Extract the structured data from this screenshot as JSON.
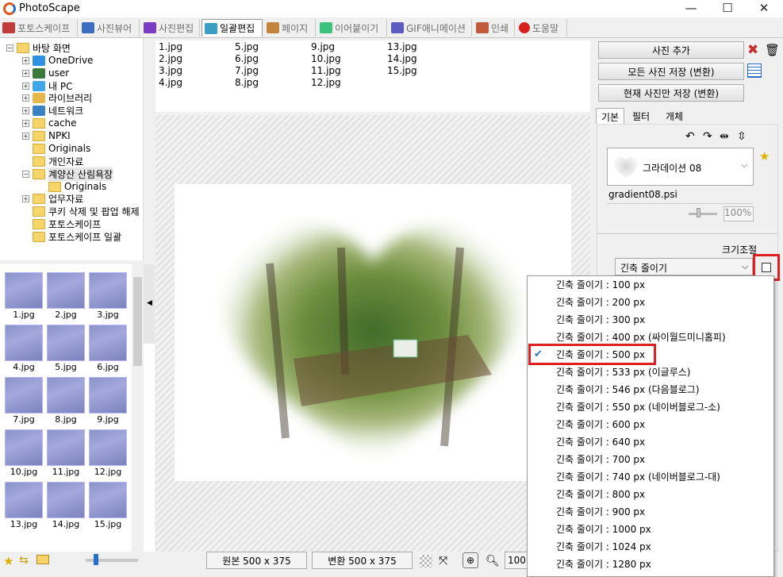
{
  "window": {
    "title": "PhotoScape",
    "minimize": "—",
    "maximize": "☐",
    "close": "✕"
  },
  "tabs": [
    {
      "label": "포토스케이프",
      "color": "#c23b3b"
    },
    {
      "label": "사진뷰어",
      "color": "#3b6ec2"
    },
    {
      "label": "사진편집",
      "color": "#7b3bc2"
    },
    {
      "label": "일괄편집",
      "color": "#3b9ec2"
    },
    {
      "label": "페이지",
      "color": "#c2853b"
    },
    {
      "label": "이어붙이기",
      "color": "#3bc27b"
    },
    {
      "label": "GIF애니메이션",
      "color": "#5b5bc2"
    },
    {
      "label": "인쇄",
      "color": "#c25b3b"
    },
    {
      "label": "도움말",
      "color": "#d62020"
    }
  ],
  "active_tab": 3,
  "tree": [
    {
      "label": "바탕 화면",
      "icon": "folder-icon"
    },
    {
      "label": "OneDrive",
      "icon": "cloud-icon"
    },
    {
      "label": "user",
      "icon": "user-icon"
    },
    {
      "label": "내 PC",
      "icon": "pc-icon"
    },
    {
      "label": "라이브러리",
      "icon": "library-icon"
    },
    {
      "label": "네트워크",
      "icon": "network-icon"
    },
    {
      "label": "cache",
      "icon": "folder-icon"
    },
    {
      "label": "NPKI",
      "icon": "folder-icon"
    },
    {
      "label": "Originals",
      "icon": "folder-icon"
    },
    {
      "label": "개인자료",
      "icon": "folder-icon"
    },
    {
      "label": "계양산 산림욕장",
      "icon": "folder-icon"
    },
    {
      "label": "Originals",
      "icon": "folder-icon"
    },
    {
      "label": "업무자료",
      "icon": "folder-icon"
    },
    {
      "label": "쿠키 삭제 및 팝업 해제",
      "icon": "folder-icon"
    },
    {
      "label": "포토스케이프",
      "icon": "folder-icon"
    },
    {
      "label": "포토스케이프 일괄",
      "icon": "folder-icon"
    }
  ],
  "thumbnails": [
    "1.jpg",
    "2.jpg",
    "3.jpg",
    "4.jpg",
    "5.jpg",
    "6.jpg",
    "7.jpg",
    "8.jpg",
    "9.jpg",
    "10.jpg",
    "11.jpg",
    "12.jpg",
    "13.jpg",
    "14.jpg",
    "15.jpg"
  ],
  "files": [
    "1.jpg",
    "2.jpg",
    "3.jpg",
    "4.jpg",
    "5.jpg",
    "6.jpg",
    "7.jpg",
    "8.jpg",
    "9.jpg",
    "10.jpg",
    "11.jpg",
    "12.jpg",
    "13.jpg",
    "14.jpg",
    "15.jpg"
  ],
  "status": {
    "original": "원본 500 x 375",
    "converted": "변환 500 x 375",
    "zoom": "100"
  },
  "panel": {
    "add_photo": "사진 추가",
    "save_all": "모든 사진 저장 (변환)",
    "save_current": "현재 사진만 저장 (변환)",
    "subtabs": [
      "기본",
      "필터",
      "개체"
    ],
    "gradient_name": "그라데이션 08",
    "gradient_file": "gradient08.psi",
    "opacity": "100%",
    "resize_label": "크기조절",
    "resize_value": "긴축 줄이기"
  },
  "dropdown_options": [
    "긴축 줄이기 : 100 px",
    "긴축 줄이기 : 200 px",
    "긴축 줄이기 : 300 px",
    "긴축 줄이기 : 400 px (싸이월드미니홈피)",
    "긴축 줄이기 : 500 px",
    "긴축 줄이기 : 533 px (이글루스)",
    "긴축 줄이기 : 546 px (다음블로그)",
    "긴축 줄이기 : 550 px (네이버블로그-소)",
    "긴축 줄이기 : 600 px",
    "긴축 줄이기 : 640 px",
    "긴축 줄이기 : 700 px",
    "긴축 줄이기 : 740 px (네이버블로그-대)",
    "긴축 줄이기 : 800 px",
    "긴축 줄이기 : 900 px",
    "긴축 줄이기 : 1000 px",
    "긴축 줄이기 : 1024 px",
    "긴축 줄이기 : 1280 px"
  ],
  "dropdown_selected": 4,
  "colors": {
    "accent": "#2a6fc9",
    "highlight": "#e02020",
    "folder": "#f7d46a"
  }
}
